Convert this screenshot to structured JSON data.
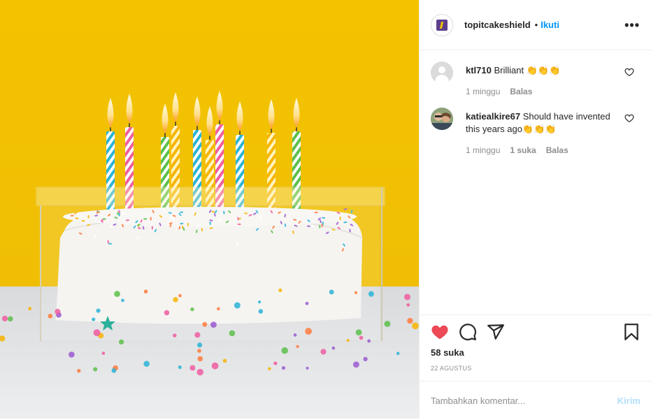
{
  "post": {
    "image_alt": "",
    "colors": {
      "background": "#f2c200",
      "frosting": "#f3f2ef",
      "table": "#e9eaec"
    }
  },
  "header": {
    "username": "topitcakeshield",
    "separator": "•",
    "follow_label": "Ikuti",
    "more_icon": "more-icon",
    "more_label": "•••"
  },
  "comments": [
    {
      "username": "ktl710",
      "text": "Brilliant 👏👏👏",
      "time": "1 minggu",
      "likes": "",
      "reply_label": "Balas",
      "avatar": "default-avatar"
    },
    {
      "username": "katiealkire67",
      "text": "Should have invented this years ago👏👏👏",
      "time": "1 minggu",
      "likes": "1 suka",
      "reply_label": "Balas",
      "avatar": "photo-avatar"
    }
  ],
  "actions": {
    "like_icon": "heart-filled-icon",
    "comment_icon": "comment-icon",
    "share_icon": "share-icon",
    "save_icon": "bookmark-icon",
    "like_color": "#ed4956",
    "likes_count": "58 suka",
    "date": "22 AGUSTUS"
  },
  "add_comment": {
    "placeholder": "Tambahkan komentar...",
    "post_label": "Kirim"
  }
}
